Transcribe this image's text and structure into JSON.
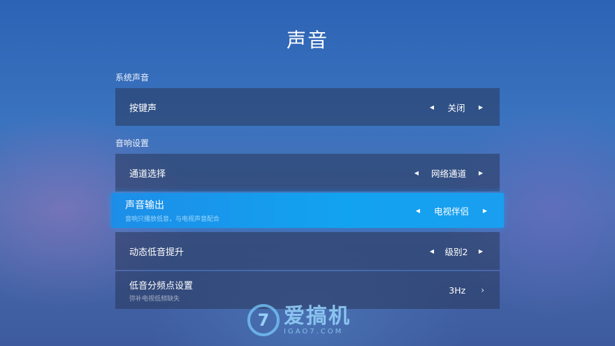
{
  "page": {
    "title": "声音"
  },
  "sections": [
    {
      "label": "系统声音"
    },
    {
      "label": "音响设置"
    }
  ],
  "rows": [
    {
      "label": "按键声",
      "value": "关闭",
      "left_arrow": "◀",
      "right_arrow": "▶"
    },
    {
      "label": "通道选择",
      "value": "网络通道",
      "left_arrow": "◀",
      "right_arrow": "▶"
    },
    {
      "label": "声音输出",
      "subtitle": "音响只播放低音，与电视声音配合",
      "value": "电视伴侣",
      "left_arrow": "◀",
      "right_arrow": "▶",
      "focused": true
    },
    {
      "label": "动态低音提升",
      "value": "级别2",
      "left_arrow": "◀",
      "right_arrow": "▶"
    },
    {
      "label": "低音分频点设置",
      "subtitle": "弥补电视低频缺失",
      "value": "3Hz",
      "chevron": "›"
    }
  ],
  "watermark": {
    "mark": "7",
    "brand": "爱搞机",
    "domain": "IGAO7.COM"
  },
  "colors": {
    "focus": "#1a9ef0",
    "row_bg": "#28375a"
  }
}
